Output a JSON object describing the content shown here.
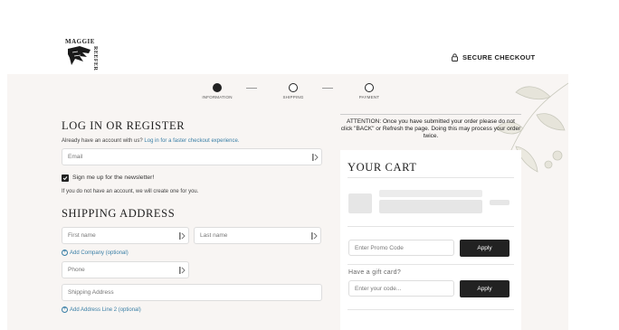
{
  "brand": {
    "line1": "MAGGIE",
    "line2": "REEFER"
  },
  "header": {
    "secure_label": "SECURE CHECKOUT"
  },
  "steps": [
    {
      "label": "INFORMATION",
      "active": true
    },
    {
      "label": "SHIPPING",
      "active": false
    },
    {
      "label": "PAYMENT",
      "active": false
    }
  ],
  "login": {
    "title": "LOG IN OR REGISTER",
    "prompt": "Already have an account with us?",
    "link": "Log in for a faster checkout experience.",
    "email_placeholder": "Email",
    "newsletter_label": "Sign me up for the newsletter!",
    "note": "If you do not have an account, we will create one for you."
  },
  "shipping": {
    "title": "SHIPPING ADDRESS",
    "first_name_placeholder": "First name",
    "last_name_placeholder": "Last name",
    "add_company": "Add Company (optional)",
    "phone_placeholder": "Phone",
    "address_placeholder": "Shipping Address",
    "add_line2": "Add Address Line 2 (optional)"
  },
  "notice": "ATTENTION: Once you have submitted your order please do not click \"BACK\" or Refresh the page. Doing this may process your order twice.",
  "cart": {
    "title": "YOUR CART",
    "promo_placeholder": "Enter Promo Code",
    "apply_label": "Apply",
    "gift_label": "Have a gift card?",
    "gift_placeholder": "Enter your code...",
    "gift_apply_label": "Apply"
  }
}
